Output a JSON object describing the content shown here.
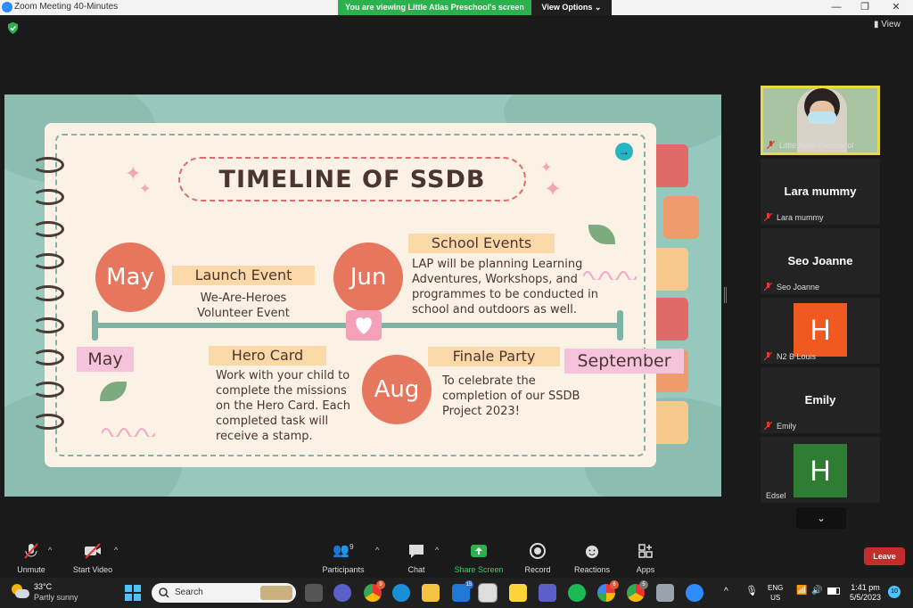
{
  "window": {
    "title": "Zoom Meeting 40-Minutes",
    "sharing_banner": "You are viewing Little Atlas Preschool's screen",
    "view_options": "View Options ⌄",
    "view_button": "View"
  },
  "slide": {
    "title": "TIMELINE OF SSDB",
    "timeline_start": "May",
    "timeline_end": "September",
    "events": {
      "may": {
        "month": "May",
        "label": "Launch Event",
        "desc_line1": "We-Are-Heroes",
        "desc_line2": "Volunteer Event"
      },
      "jun": {
        "month": "Jun",
        "label": "School Events",
        "desc_line1": "LAP will be planning Learning",
        "desc_line2": "Adventures, Workshops, and",
        "desc_line3": "programmes to be conducted in",
        "desc_line4": "school and outdoors as well."
      },
      "hero": {
        "label": "Hero Card",
        "desc_line1": "Work with your child to",
        "desc_line2": "complete the missions",
        "desc_line3": "on the Hero Card. Each",
        "desc_line4": "completed task will",
        "desc_line5": "receive a stamp."
      },
      "aug": {
        "month": "Aug",
        "label": "Finale Party",
        "desc_line1": "To celebrate the",
        "desc_line2": "completion of our SSDB",
        "desc_line3": "Project 2023!"
      }
    },
    "colors": {
      "background": "#96c8bd",
      "paper": "#fbf1e4",
      "circle": "#e6765d",
      "label": "#fbd8a8",
      "pink": "#f6c3dd"
    }
  },
  "participants": [
    {
      "name": "Little Atlas Preschool",
      "type": "video"
    },
    {
      "name": "Lara mummy",
      "display": "Lara mummy",
      "type": "name"
    },
    {
      "name": "Seo Joanne",
      "display": "Seo Joanne",
      "type": "name"
    },
    {
      "name": "N2 B Louis",
      "initial": "H",
      "color": "#f05a22",
      "type": "avatar"
    },
    {
      "name": "Emily",
      "display": "Emily",
      "type": "name"
    },
    {
      "name": "Edsel",
      "initial": "H",
      "color": "#2e7d32",
      "type": "avatar"
    }
  ],
  "toolbar": {
    "unmute": "Unmute",
    "start_video": "Start Video",
    "participants": "Participants",
    "participants_count": "9",
    "chat": "Chat",
    "share_screen": "Share Screen",
    "record": "Record",
    "reactions": "Reactions",
    "apps": "Apps",
    "leave": "Leave"
  },
  "taskbar": {
    "weather_temp": "33°C",
    "weather_desc": "Partly sunny",
    "search_placeholder": "Search",
    "language_line1": "ENG",
    "language_line2": "US",
    "time": "1:41 pm",
    "date": "5/5/2023",
    "notification_count": "10",
    "badges": {
      "chrome1": "9",
      "mail": "15",
      "chrome2": "5",
      "photos": "6"
    }
  }
}
